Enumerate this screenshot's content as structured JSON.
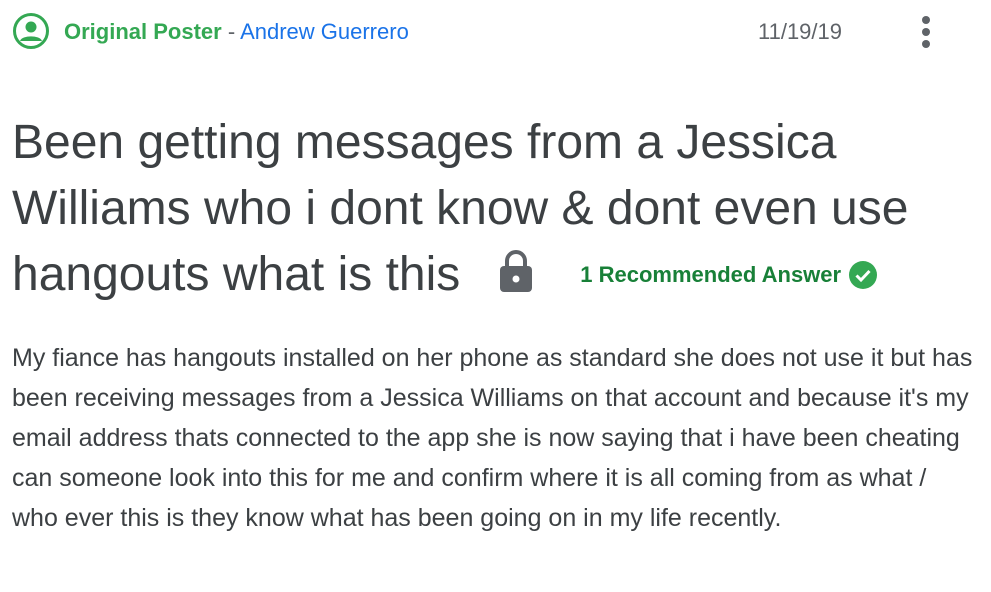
{
  "post": {
    "poster_role": "Original Poster",
    "separator": " - ",
    "poster_name": "Andrew Guerrero",
    "date": "11/19/19",
    "title": "Been getting messages from a Jessica Williams who i dont know & dont even use hangouts what is this",
    "recommended_answer": "1 Recommended Answer",
    "body": "My fiance has hangouts installed on her phone as standard she does not use it but has been receiving messages from a Jessica Williams on that account and because it's my email address thats connected to the app she is now saying that i have been cheating can someone look into this for me and confirm where it is all coming from as what / who ever this is they know what has been going on in my life recently."
  },
  "icons": {
    "avatar": "account-circle-icon",
    "menu": "more-vert-icon",
    "lock": "lock-icon",
    "check": "check-circle-icon"
  },
  "colors": {
    "poster_role": "#34a853",
    "poster_name": "#1a73e8",
    "recommended": "#188038",
    "check": "#34a853",
    "text": "#3c4043",
    "muted": "#5f6368"
  }
}
